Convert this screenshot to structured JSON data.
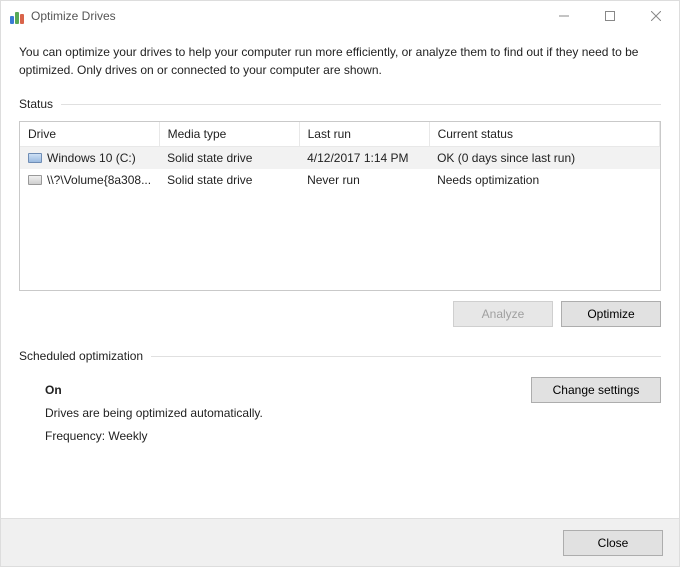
{
  "window": {
    "title": "Optimize Drives"
  },
  "description": "You can optimize your drives to help your computer run more efficiently, or analyze them to find out if they need to be optimized. Only drives on or connected to your computer are shown.",
  "status_section_label": "Status",
  "table": {
    "headers": {
      "drive": "Drive",
      "media_type": "Media type",
      "last_run": "Last run",
      "current_status": "Current status"
    },
    "rows": [
      {
        "icon": "drive-ssd",
        "drive": "Windows 10 (C:)",
        "media_type": "Solid state drive",
        "last_run": "4/12/2017 1:14 PM",
        "current_status": "OK (0 days since last run)",
        "selected": true
      },
      {
        "icon": "drive-volume",
        "drive": "\\\\?\\Volume{8a308...",
        "media_type": "Solid state drive",
        "last_run": "Never run",
        "current_status": "Needs optimization",
        "selected": false
      }
    ]
  },
  "buttons": {
    "analyze": "Analyze",
    "optimize": "Optimize",
    "change_settings": "Change settings",
    "close": "Close"
  },
  "scheduled": {
    "section_label": "Scheduled optimization",
    "state": "On",
    "detail": "Drives are being optimized automatically.",
    "frequency_label": "Frequency: Weekly"
  }
}
